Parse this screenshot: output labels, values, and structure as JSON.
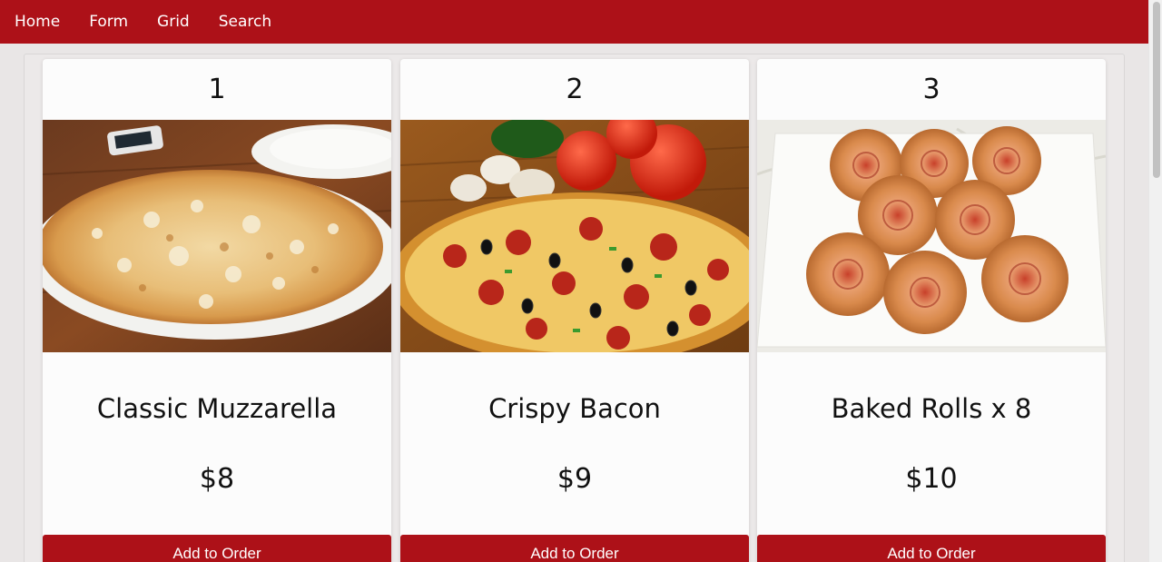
{
  "nav": {
    "links": [
      {
        "label": "Home"
      },
      {
        "label": "Form"
      },
      {
        "label": "Grid"
      },
      {
        "label": "Search"
      }
    ]
  },
  "colors": {
    "brand": "#ad1118",
    "page_bg": "#e9e6e6",
    "card_bg": "#fcfcfc"
  },
  "products": [
    {
      "number": "1",
      "title": "Classic Muzzarella",
      "price": "$8",
      "button": "Add to Order",
      "image": "cheese-pizza-photo"
    },
    {
      "number": "2",
      "title": "Crispy Bacon",
      "price": "$9",
      "button": "Add to Order",
      "image": "pepperoni-pizza-photo"
    },
    {
      "number": "3",
      "title": "Baked Rolls x 8",
      "price": "$10",
      "button": "Add to Order",
      "image": "pizza-rolls-photo"
    }
  ]
}
